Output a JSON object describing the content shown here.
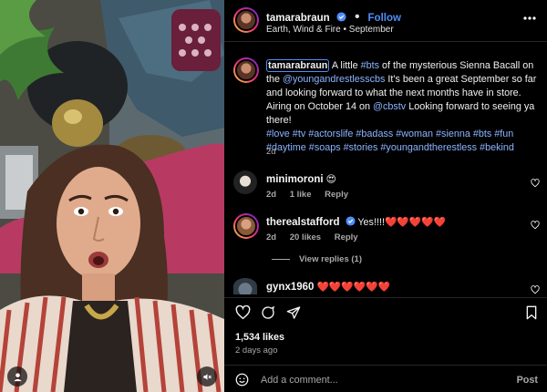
{
  "post": {
    "username": "tamarabraun",
    "follow_label": "Follow",
    "sub_left": "Earth, Wind & Fire",
    "sub_sep": "•",
    "sub_right": "September",
    "more_icon": "more-horizontal-icon"
  },
  "caption": {
    "username": "tamarabraun",
    "t1": " A little ",
    "tag1": "#bts",
    "t2": " of the mysterious Sienna Bacall on the ",
    "mention1": "@youngandrestlesscbs",
    "t3": " It's been a great September so far and looking forward to what the next months have in store. Airing on October 14 on ",
    "mention2": "@cbstv",
    "t4": " Looking forward to seeing ya there!",
    "hashtags": "#love #tv #actorslife #badass #woman #sienna #bts #fun #daytime #soaps #stories #youngandtherestless #bekind",
    "time": "2d"
  },
  "comments": [
    {
      "username": "minimoroni",
      "text": "😍",
      "time": "2d",
      "likes": "1 like",
      "reply": "Reply"
    },
    {
      "username": "therealstafford",
      "text": "Yes!!!!❤️❤️❤️❤️❤️",
      "time": "2d",
      "likes": "20 likes",
      "reply": "Reply"
    },
    {
      "username": "gynx1960",
      "text": "❤️❤️❤️❤️❤️❤️"
    }
  ],
  "view_replies": "View replies (1)",
  "actions": {
    "likes": "1,534 likes",
    "ago": "2 days ago"
  },
  "composer": {
    "placeholder": "Add a comment...",
    "post_label": "Post"
  },
  "colors": {
    "accent": "#4f8df8",
    "link": "#8cb4ff",
    "bg": "#000000"
  }
}
